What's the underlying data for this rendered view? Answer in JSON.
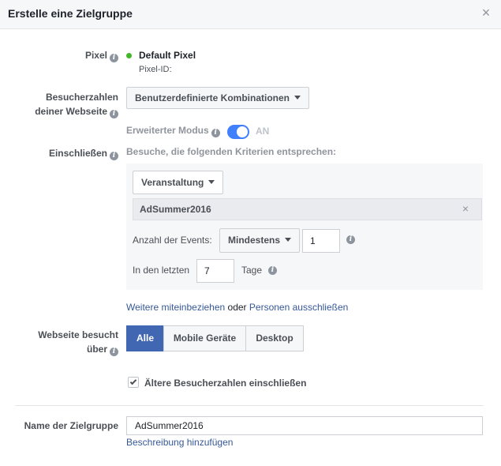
{
  "header": {
    "title": "Erstelle eine Zielgruppe",
    "close": "×"
  },
  "pixel": {
    "label": "Pixel",
    "name": "Default Pixel",
    "id_label": "Pixel-ID:"
  },
  "visitors": {
    "label_line1": "Besucherzahlen",
    "label_line2": "deiner Webseite",
    "dropdown": "Benutzerdefinierte Kombinationen"
  },
  "advanced_mode": {
    "label": "Erweiterter Modus",
    "state": "AN",
    "enabled": true
  },
  "include": {
    "label": "Einschließen",
    "hint": "Besuche, die folgenden Kriterien entsprechen:",
    "event_type": "Veranstaltung",
    "event_name": "AdSummer2016",
    "remove": "×",
    "event_count_label": "Anzahl der Events:",
    "event_count_op": "Mindestens",
    "event_count_value": "1",
    "in_last_label": "In den letzten",
    "in_last_value": "7",
    "days_label": "Tage"
  },
  "links": {
    "include_more": "Weitere miteinbeziehen",
    "or": "oder",
    "exclude": "Personen ausschließen"
  },
  "device": {
    "label_line1": "Webseite besucht",
    "label_line2": "über",
    "options": [
      "Alle",
      "Mobile Geräte",
      "Desktop"
    ],
    "selected": "Alle"
  },
  "older_visitors": {
    "label": "Ältere Besucherzahlen einschließen",
    "checked": true
  },
  "audience": {
    "label": "Name der Zielgruppe",
    "value": "AdSummer2016",
    "add_description": "Beschreibung hinzufügen"
  }
}
